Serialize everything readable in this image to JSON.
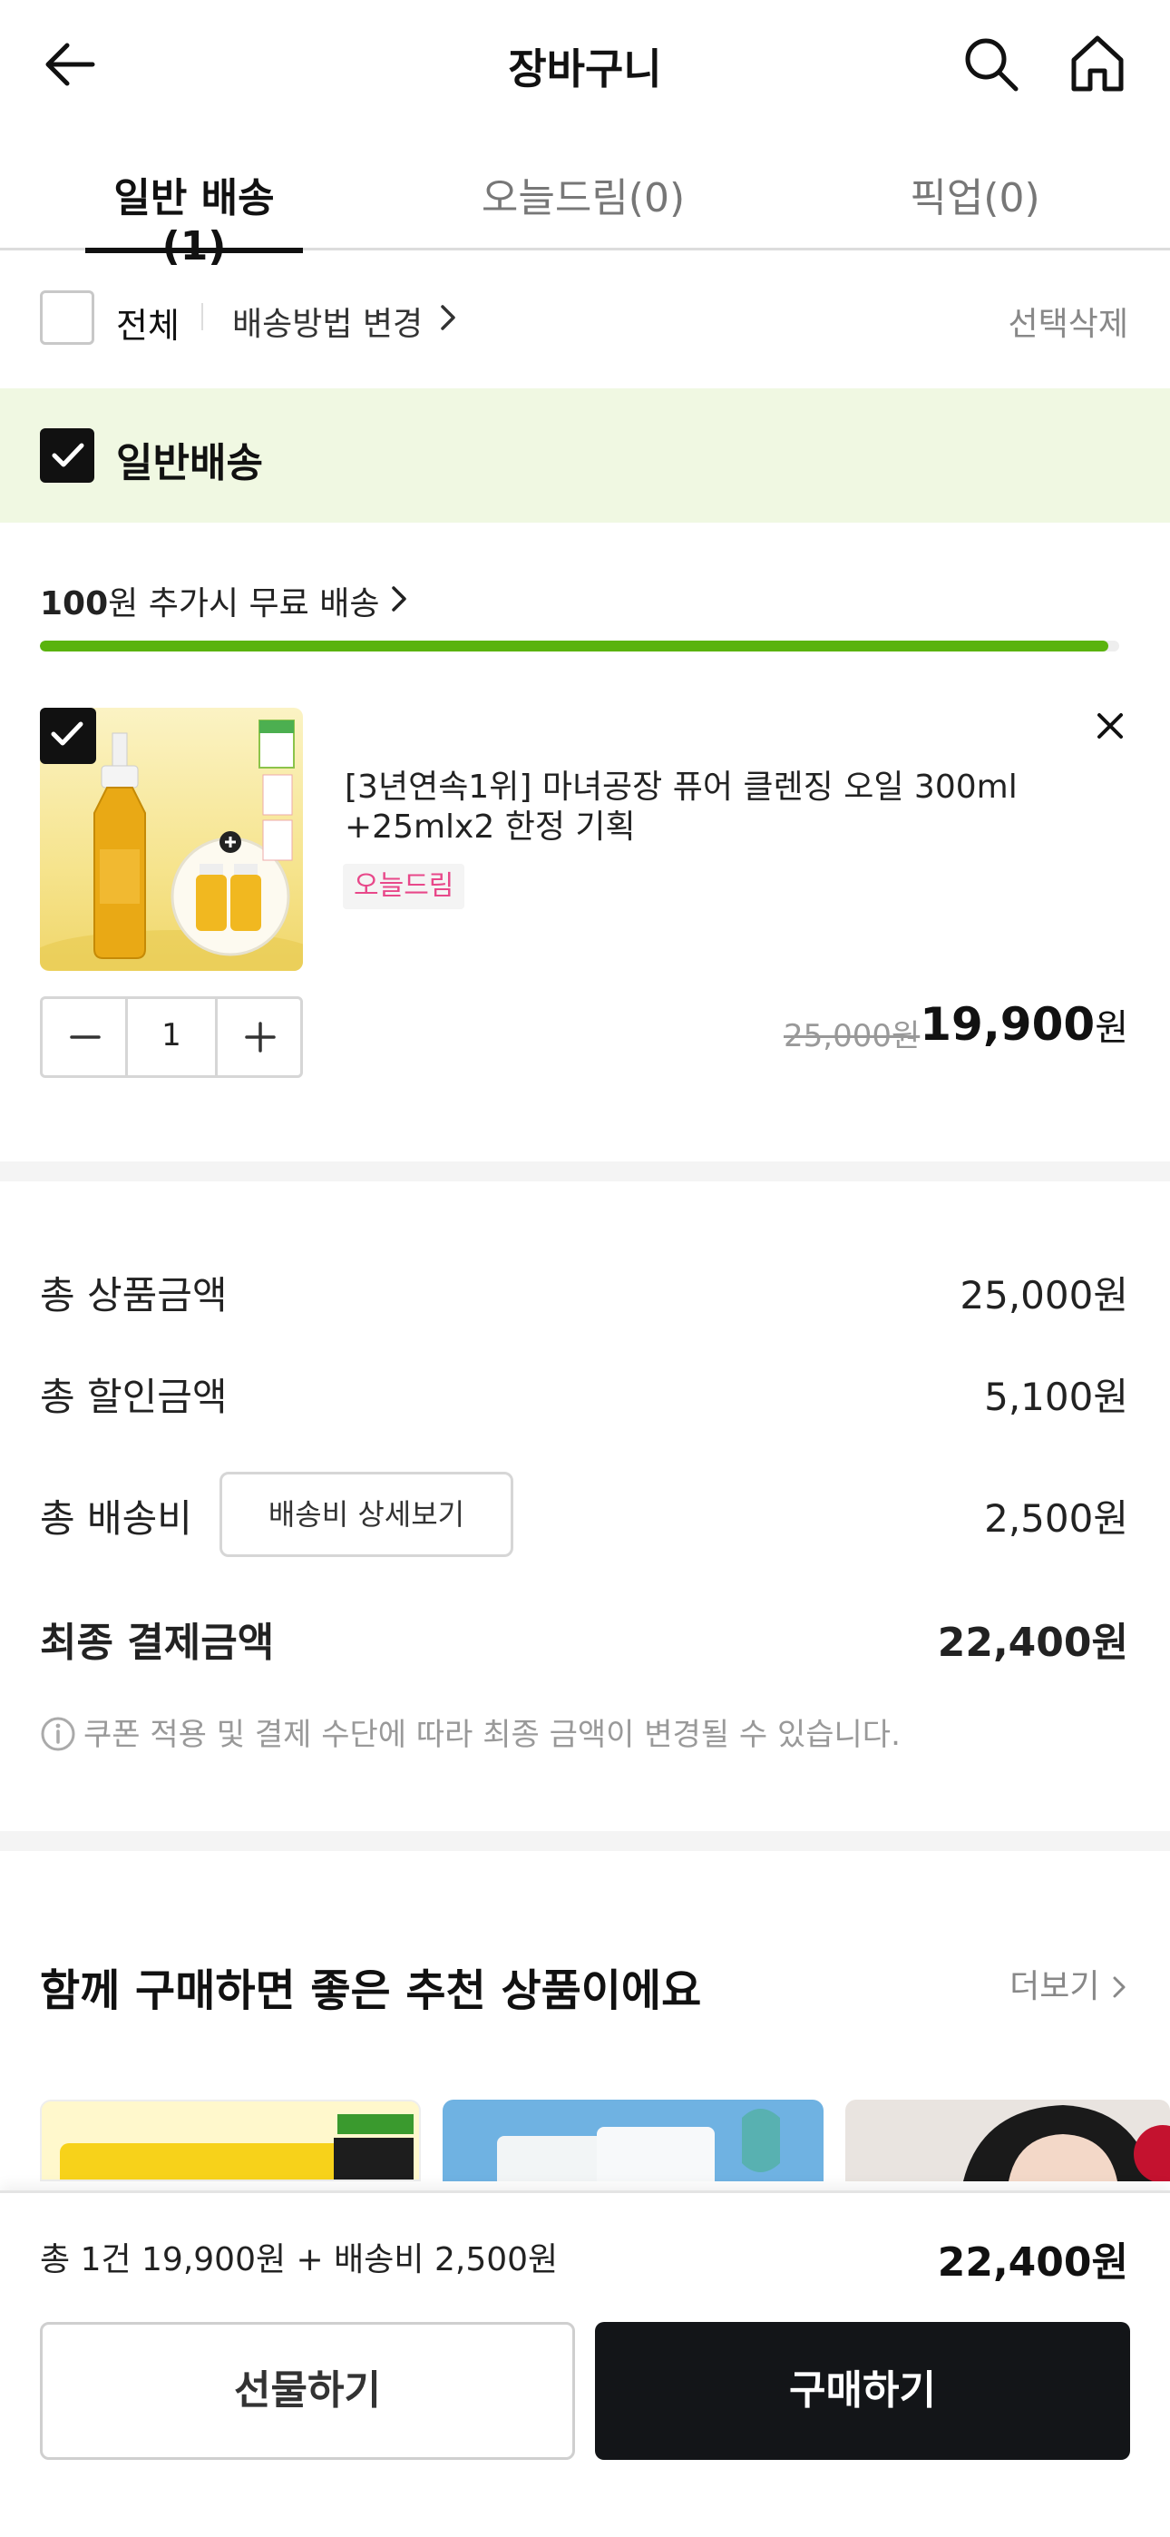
{
  "header": {
    "title": "장바구니",
    "back_icon": "arrow-left-icon",
    "search_icon": "search-icon",
    "home_icon": "home-icon"
  },
  "tabs": [
    {
      "label": "일반 배송(1)",
      "active": true
    },
    {
      "label": "오늘드림(0)",
      "active": false
    },
    {
      "label": "픽업(0)",
      "active": false
    }
  ],
  "toolbar": {
    "select_all": "전체",
    "change_delivery": "배송방법 변경",
    "delete_selected": "선택삭제"
  },
  "section": {
    "title": "일반배송",
    "checked": true
  },
  "free_shipping": {
    "amount": "100",
    "text": "원 추가시 무료 배송",
    "progress": 0.99
  },
  "product": {
    "name": "[3년연속1위] 마녀공장 퓨어 클렌징 오일 300ml +25mlx2 한정 기획",
    "badge": "오늘드림",
    "quantity": "1",
    "original_price": "25,000원",
    "sale_price": "19,900",
    "currency": "원",
    "checked": true
  },
  "summary": {
    "total_product_label": "총 상품금액",
    "total_product_value": "25,000원",
    "total_discount_label": "총 할인금액",
    "total_discount_value": "5,100원",
    "shipping_label": "총 배송비",
    "shipping_detail_button": "배송비 상세보기",
    "shipping_value": "2,500원",
    "final_label": "최종 결제금액",
    "final_value": "22,400원",
    "notice": "쿠폰 적용 및 결제 수단에 따라 최종 금액이 변경될 수 있습니다."
  },
  "recommend": {
    "title": "함께 구매하면 좋은 추천 상품이에요",
    "more": "더보기"
  },
  "bottom": {
    "summary": "총 1건 19,900원 + 배송비 2,500원",
    "total": "22,400원",
    "gift_button": "선물하기",
    "buy_button": "구매하기"
  },
  "colors": {
    "accent_green": "#5ab30e",
    "section_bg": "#f0f8e2",
    "badge_pink": "#e8488a",
    "primary_dark": "#131518"
  }
}
